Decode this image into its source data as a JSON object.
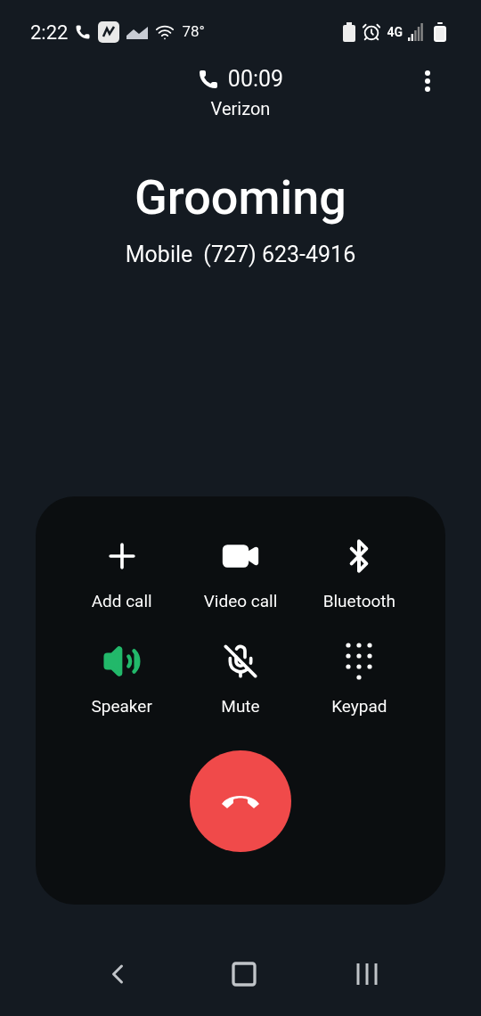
{
  "status_bar": {
    "time": "2:22",
    "temperature": "78°",
    "network": "4G"
  },
  "call": {
    "timer": "00:09",
    "carrier": "Verizon",
    "name": "Grooming",
    "number_type": "Mobile",
    "number": "(727) 623-4916"
  },
  "controls": [
    {
      "kind": "add",
      "label": "Add call",
      "on": false
    },
    {
      "kind": "video",
      "label": "Video call",
      "on": false
    },
    {
      "kind": "bluetooth",
      "label": "Bluetooth",
      "on": false
    },
    {
      "kind": "speaker",
      "label": "Speaker",
      "on": true
    },
    {
      "kind": "mute",
      "label": "Mute",
      "on": false
    },
    {
      "kind": "keypad",
      "label": "Keypad",
      "on": false
    }
  ]
}
